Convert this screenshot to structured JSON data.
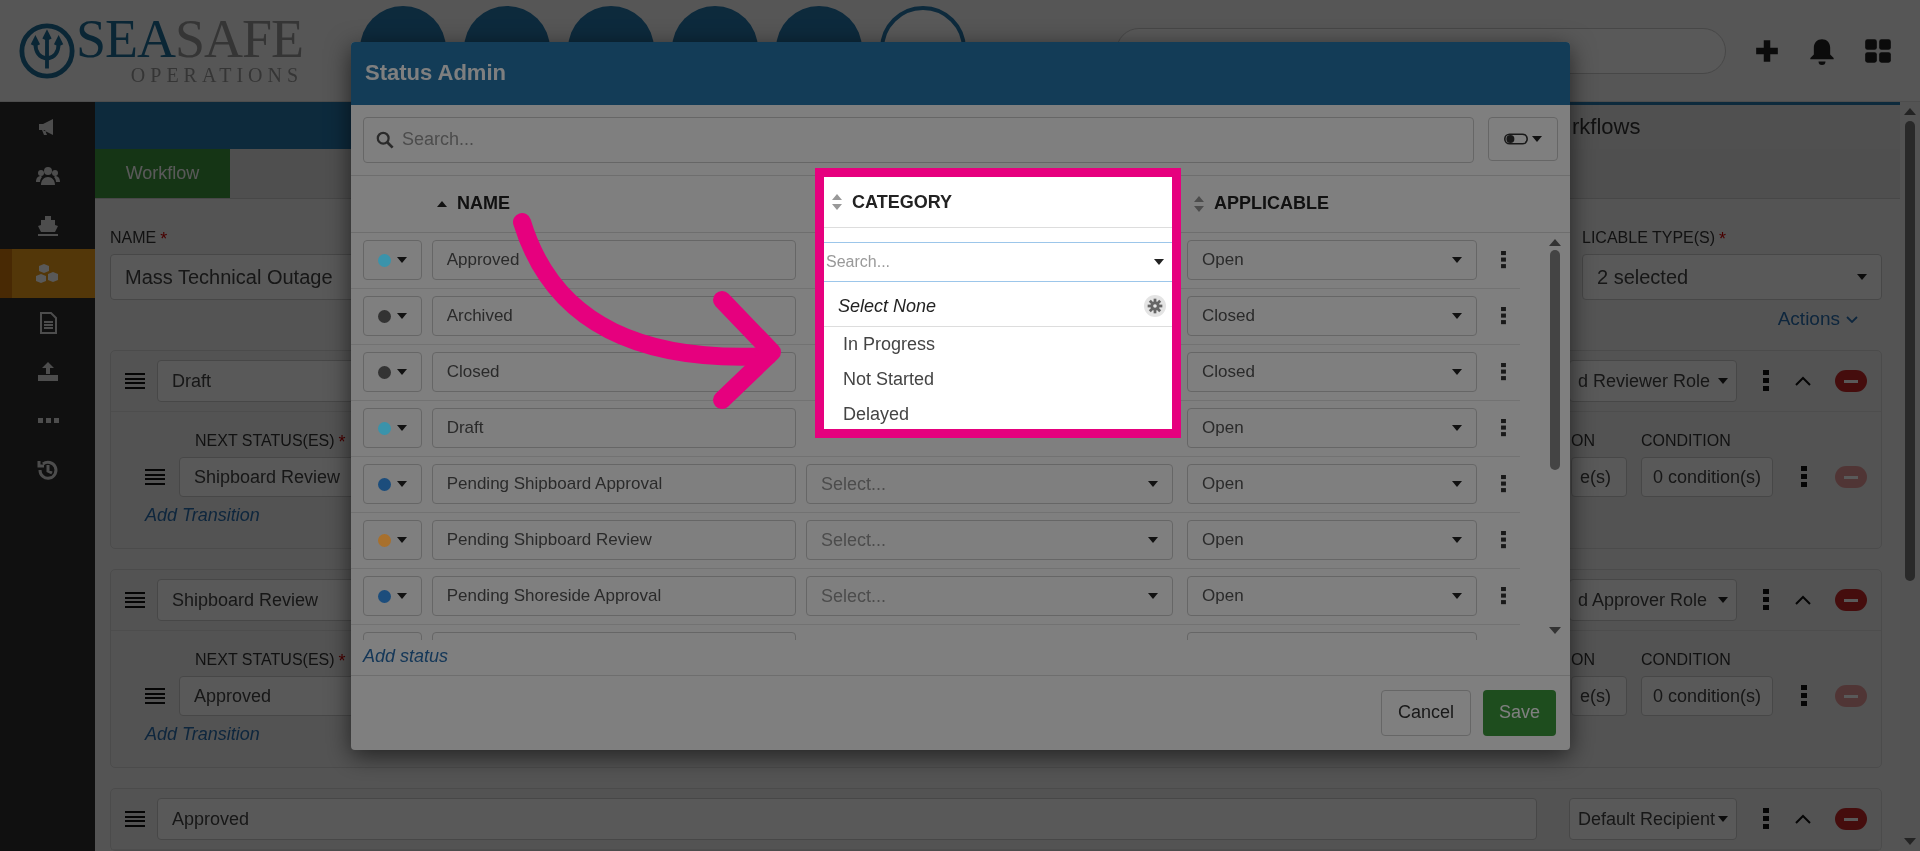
{
  "brand": {
    "name_first": "SEA",
    "name_second": "SAFE",
    "subtitle": "OPERATIONS"
  },
  "sidebar": {
    "items": [
      {
        "selected": false
      },
      {
        "selected": false
      },
      {
        "selected": false
      },
      {
        "selected": true
      },
      {
        "selected": false
      },
      {
        "selected": false
      },
      {
        "selected": false
      },
      {
        "selected": false
      }
    ]
  },
  "page": {
    "title": "rkflows",
    "required_mark": "*",
    "tab": "Workflow",
    "name_label": "NAME",
    "name_value": "Mass Technical Outage",
    "types_label": "LICABLE TYPE(S)",
    "types_value": "2 selected",
    "actions": "Actions",
    "stages": [
      {
        "status": "Draft",
        "role": "d Reviewer Role",
        "next_label": "NEXT STATUS(ES)",
        "next_value": "Shipboard Review",
        "add": "Add Transition",
        "col_a": "ON",
        "col_a_value": "e(s)",
        "col_b": "CONDITION",
        "col_b_value": "0 condition(s)"
      },
      {
        "status": "Shipboard Review",
        "role": "d Approver Role",
        "next_label": "NEXT STATUS(ES)",
        "next_value": "Approved",
        "add": "Add Transition",
        "col_a": "ON",
        "col_a_value": "e(s)",
        "col_b": "CONDITION",
        "col_b_value": "0 condition(s)"
      },
      {
        "status": "Approved",
        "role": "Default Recipient"
      }
    ]
  },
  "modal": {
    "title": "Status Admin",
    "search_placeholder": "Search...",
    "columns": [
      {
        "label": "NAME",
        "sorted": true
      },
      {
        "label": "CATEGORY",
        "sorted": false
      },
      {
        "label": "APPLICABLE",
        "sorted": false
      }
    ],
    "rows": [
      {
        "name": "Approved",
        "color": "#3a93ab",
        "applicable": "Open"
      },
      {
        "name": "Archived",
        "color": "#333333",
        "applicable": "Closed"
      },
      {
        "name": "Closed",
        "color": "#333333",
        "applicable": "Closed"
      },
      {
        "name": "Draft",
        "color": "#3a93ab",
        "applicable": "Open"
      },
      {
        "name": "Pending Shipboard Approval",
        "color": "#1c4d7c",
        "category": "Select...",
        "applicable": "Open"
      },
      {
        "name": "Pending Shipboard Review",
        "color": "#a8702c",
        "category": "Select...",
        "applicable": "Open"
      },
      {
        "name": "Pending Shoreside Approval",
        "color": "#1c4d7c",
        "category": "Select...",
        "applicable": "Open"
      },
      {}
    ],
    "add_status": "Add status",
    "cancel": "Cancel",
    "save": "Save"
  },
  "dropdown": {
    "search_placeholder": "Search...",
    "select_none": "Select None",
    "options": [
      "In Progress",
      "Not Started",
      "Delayed"
    ]
  }
}
